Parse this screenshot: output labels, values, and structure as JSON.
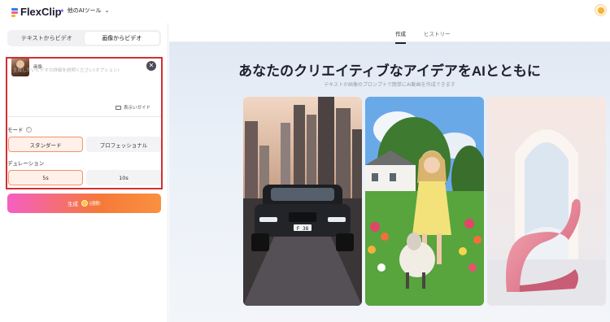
{
  "header": {
    "logo_text": "FlexClip",
    "ai_tools_label": "他のAIツール"
  },
  "left_panel": {
    "tabs": [
      {
        "label": "テキストからビデオ",
        "active": false
      },
      {
        "label": "画像からビデオ",
        "active": true
      }
    ],
    "image_label": "画像",
    "prompt_placeholder": "生成したいビデオの詳細を説明ください(オプション)",
    "guide_label": "表示いガイド",
    "mode_label": "モード",
    "mode_options": [
      {
        "label": "スタンダード",
        "selected": true
      },
      {
        "label": "プロフェッショナル",
        "selected": false
      }
    ],
    "duration_label": "デュレーション",
    "duration_options": [
      {
        "label": "5s",
        "selected": true
      },
      {
        "label": "10s",
        "selected": false
      }
    ],
    "generate_label": "生成",
    "generate_cost": "-10"
  },
  "main": {
    "tabs": [
      {
        "label": "作成",
        "active": true
      },
      {
        "label": "ヒストリー",
        "active": false
      }
    ],
    "headline": "あなたのクリエイティブなアイデアをAIとともに",
    "subheadline": "テキストか画像のプロンプトで簡単にAI動画を作成できます",
    "car_plate": "F 38"
  },
  "colors": {
    "accent_orange": "#f2936a",
    "highlight_red": "#d42f2f",
    "gradient_start": "#f45fc1",
    "gradient_end": "#f9913f"
  }
}
